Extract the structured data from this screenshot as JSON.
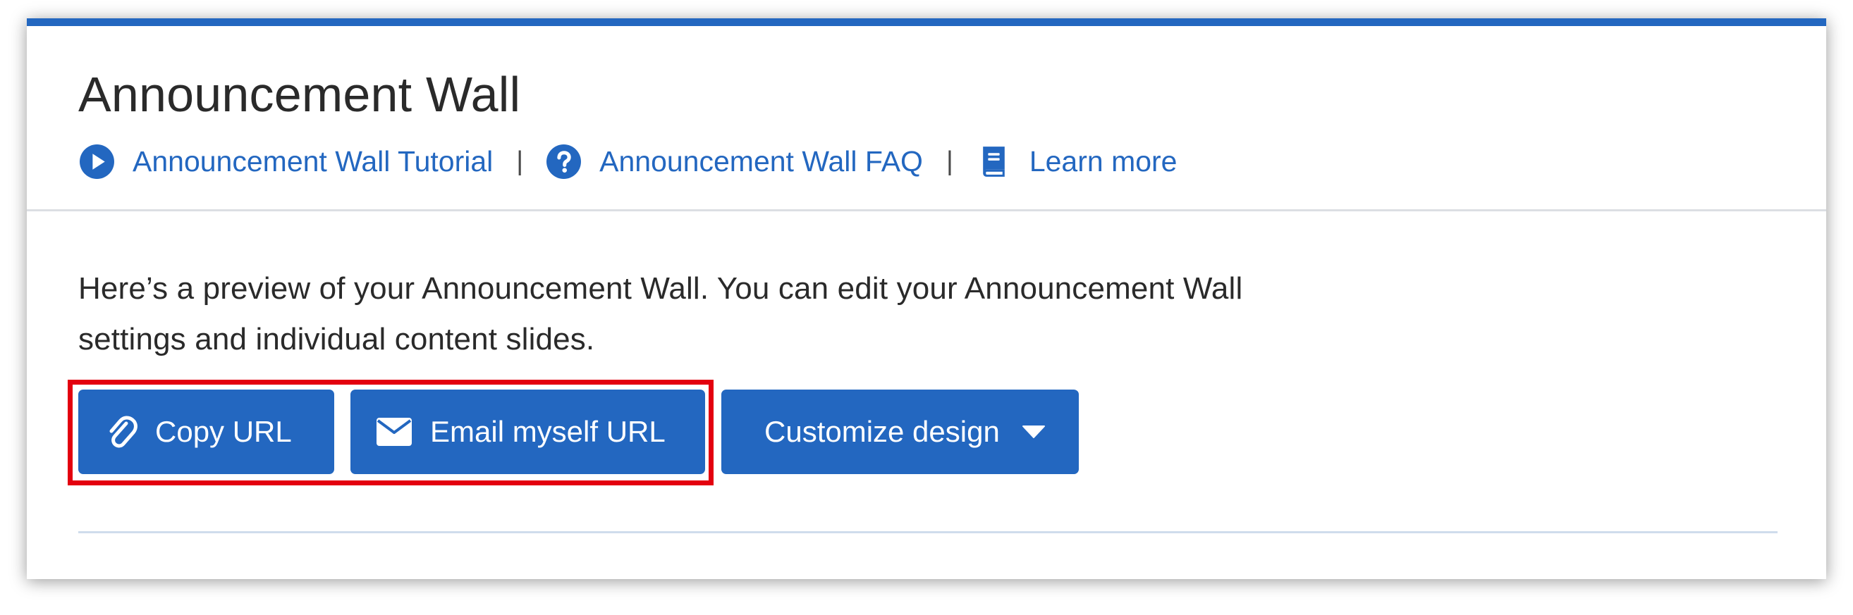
{
  "header": {
    "title": "Announcement Wall",
    "links": [
      {
        "label": "Announcement Wall Tutorial",
        "icon": "play-circle-icon"
      },
      {
        "label": "Announcement Wall FAQ",
        "icon": "question-circle-icon"
      },
      {
        "label": "Learn more",
        "icon": "book-icon"
      }
    ],
    "separator": "|"
  },
  "main": {
    "description_line1": "Here’s a preview of your Announcement Wall. You can edit your Announcement Wall",
    "description_line2": "settings and individual content slides.",
    "buttons": {
      "copy_url": {
        "label": "Copy URL",
        "icon": "paperclip-icon"
      },
      "email_url": {
        "label": "Email myself URL",
        "icon": "envelope-icon"
      },
      "customize": {
        "label": "Customize design",
        "icon": "caret-down-icon"
      }
    }
  },
  "colors": {
    "accent": "#2367c0",
    "highlight": "#e3000f",
    "text": "#2a2a2a",
    "divider": "#cfdcec"
  }
}
